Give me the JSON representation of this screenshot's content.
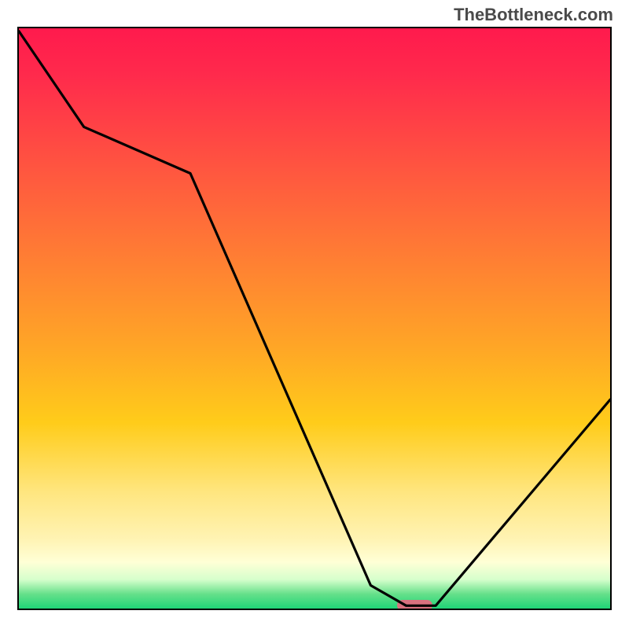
{
  "watermark": "TheBottleneck.com",
  "chart_data": {
    "type": "line",
    "title": "",
    "xlabel": "",
    "ylabel": "",
    "xlim": [
      0,
      100
    ],
    "ylim": [
      0,
      100
    ],
    "x": [
      0,
      11,
      29,
      59.5,
      65.5,
      70.5,
      100
    ],
    "values": [
      99.5,
      83,
      75,
      4,
      0.5,
      0.5,
      36
    ],
    "marker": {
      "x_start": 64,
      "x_end": 70,
      "y": 0.5
    },
    "gradient_stops": [
      {
        "pct": 0,
        "color": "#ff1a4d"
      },
      {
        "pct": 8,
        "color": "#ff2a4c"
      },
      {
        "pct": 24,
        "color": "#ff5540"
      },
      {
        "pct": 40,
        "color": "#ff7f33"
      },
      {
        "pct": 55,
        "color": "#ffa626"
      },
      {
        "pct": 68,
        "color": "#ffcc1a"
      },
      {
        "pct": 80,
        "color": "#ffe680"
      },
      {
        "pct": 88,
        "color": "#fff3b3"
      },
      {
        "pct": 92,
        "color": "#ffffd6"
      },
      {
        "pct": 95,
        "color": "#d6ffcc"
      },
      {
        "pct": 97.5,
        "color": "#66e08a"
      },
      {
        "pct": 100,
        "color": "#1fd477"
      }
    ]
  },
  "colors": {
    "axis": "#000000",
    "curve": "#000000",
    "marker": "#d8717f",
    "watermark": "#4a4a4a"
  }
}
